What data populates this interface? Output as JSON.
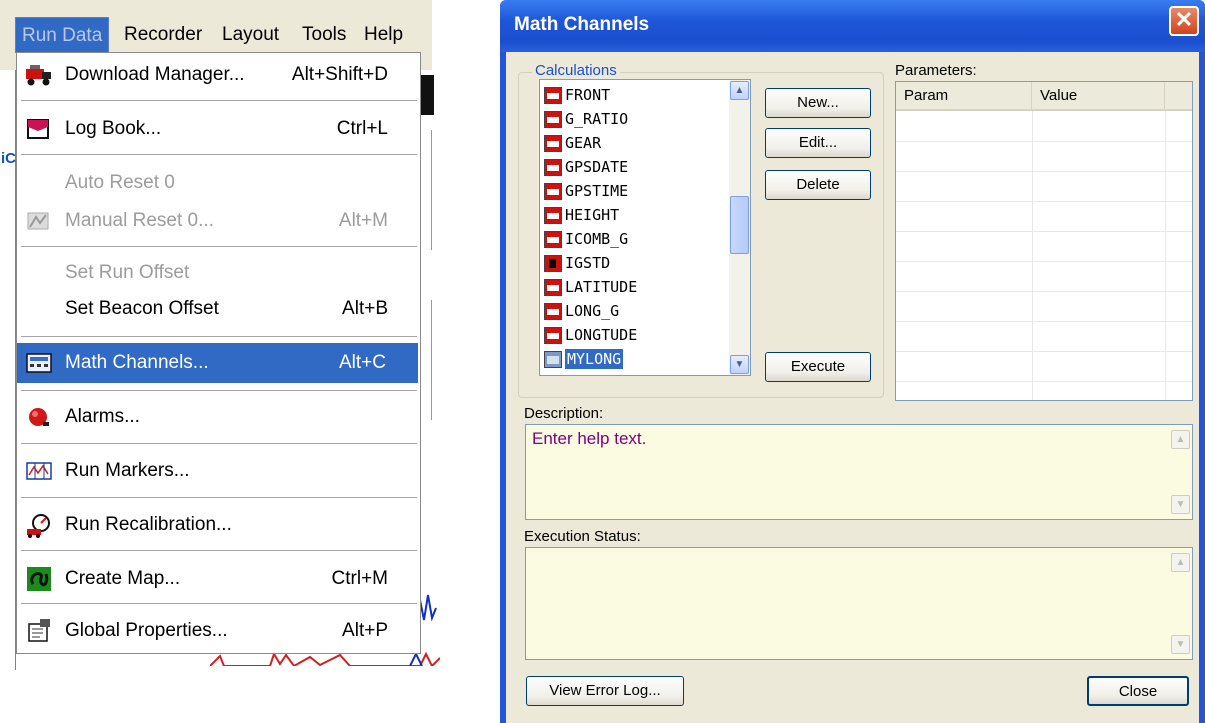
{
  "menubar": {
    "items": [
      "Run Data",
      "Recorder",
      "Layout",
      "Tools",
      "Help"
    ]
  },
  "strip_text": "iC",
  "menu": {
    "items": [
      {
        "label": "Download Manager...",
        "shortcut": "Alt+Shift+D",
        "icon": "truck-icon",
        "disabled": false
      },
      {
        "label": "Log Book...",
        "shortcut": "Ctrl+L",
        "icon": "logbook-icon",
        "disabled": false
      },
      {
        "label": "Auto Reset 0",
        "shortcut": "",
        "icon": "",
        "disabled": true
      },
      {
        "label": "Manual Reset 0...",
        "shortcut": "Alt+M",
        "icon": "reset-icon",
        "disabled": true
      },
      {
        "label": "Set Run Offset",
        "shortcut": "",
        "icon": "",
        "disabled": true
      },
      {
        "label": "Set Beacon Offset",
        "shortcut": "Alt+B",
        "icon": "",
        "disabled": false
      },
      {
        "label": "Math Channels...",
        "shortcut": "Alt+C",
        "icon": "calculator-icon",
        "disabled": false,
        "selected": true
      },
      {
        "label": "Alarms...",
        "shortcut": "",
        "icon": "alarm-icon",
        "disabled": false
      },
      {
        "label": "Run Markers...",
        "shortcut": "",
        "icon": "markers-icon",
        "disabled": false
      },
      {
        "label": "Run Recalibration...",
        "shortcut": "",
        "icon": "recalibration-icon",
        "disabled": false
      },
      {
        "label": "Create Map...",
        "shortcut": "Ctrl+M",
        "icon": "map-icon",
        "disabled": false
      },
      {
        "label": "Global Properties...",
        "shortcut": "Alt+P",
        "icon": "properties-icon",
        "disabled": false
      }
    ]
  },
  "dialog": {
    "title": "Math Channels",
    "calculations_label": "Calculations",
    "calculations": [
      "FRONT",
      "G_RATIO",
      "GEAR",
      "GPSDATE",
      "GPSTIME",
      "HEIGHT",
      "ICOMB_G",
      "IGSTD",
      "LATITUDE",
      "LONG_G",
      "LONGTUDE",
      "MYLONG"
    ],
    "selected_calculation": "MYLONG",
    "buttons": {
      "new": "New...",
      "edit": "Edit...",
      "delete": "Delete",
      "execute": "Execute",
      "view_error_log": "View Error Log...",
      "close": "Close"
    },
    "parameters_label": "Parameters:",
    "param_columns": [
      "Param",
      "Value"
    ],
    "description_label": "Description:",
    "description_text": "Enter help text.",
    "execution_status_label": "Execution Status:",
    "execution_status_text": ""
  }
}
